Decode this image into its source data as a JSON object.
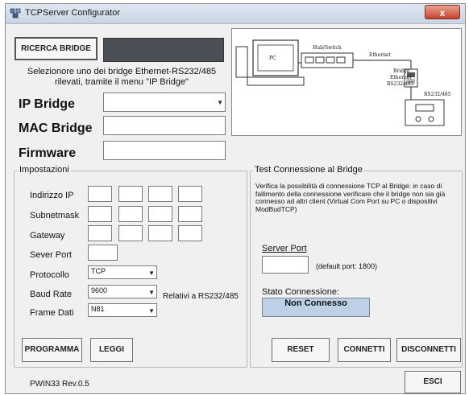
{
  "window": {
    "title": "TCPServer Configurator",
    "close_label": "x"
  },
  "search": {
    "button_label": "RICERCA BRIDGE",
    "instructions": "Selezionore uno dei bridge Ethernet-RS232/485\nrilevati, tramite il menu \"IP Bridge\""
  },
  "device": {
    "ip_label": "IP Bridge",
    "mac_label": "MAC Bridge",
    "firmware_label": "Firmware",
    "ip_value": "",
    "mac_value": "",
    "firmware_value": ""
  },
  "diagram": {
    "pc": "PC",
    "hub": "Hub/Switch",
    "ethernet": "Ethernet",
    "bridge_line1": "Bridge",
    "bridge_line2": "Ethernet",
    "bridge_line3": "RS232/485",
    "rs_label": "RS232/485"
  },
  "settings": {
    "group_title": "Impostazioni",
    "ip_label": "Indirizzo IP",
    "subnet_label": "Subnetmask",
    "gateway_label": "Gateway",
    "port_label": "Sever Port",
    "protocol_label": "Protocollo",
    "baud_label": "Baud Rate",
    "frame_label": "Frame Dati",
    "protocol_value": "TCP",
    "baud_value": "9600",
    "frame_value": "N81",
    "relativi_note": "Relativi a RS232/485",
    "program_button": "PROGRAMMA",
    "read_button": "LEGGI"
  },
  "test": {
    "group_title": "Test Connessione al Bridge",
    "description": "Verifica la possibilità di connessione TCP al Bridge: in caso di fallimento della connessione verificare che il bridge non sia già connesso ad altri client (Virtual Com Port su PC o dispositivi ModBudTCP)",
    "server_port_label": "Server Port",
    "server_port_value": "",
    "default_port_note": "(default port: 1800)",
    "status_label": "Stato Connessione:",
    "status_value": "Non Connesso",
    "reset_button": "RESET",
    "connect_button": "CONNETTI",
    "disconnect_button": "DISCONNETTI"
  },
  "footer": {
    "version": "PWIN33 Rev.0.5",
    "exit_button": "ESCI"
  }
}
